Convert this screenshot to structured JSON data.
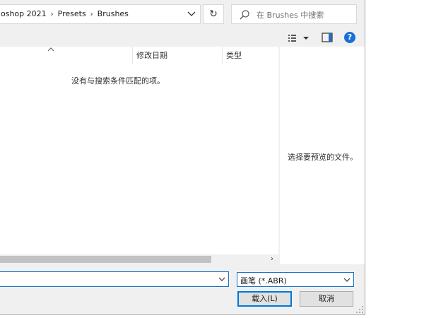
{
  "address": {
    "crumbs": [
      "oshop 2021",
      "Presets",
      "Brushes"
    ],
    "separator": "›",
    "refresh_glyph": "↻"
  },
  "search": {
    "placeholder": "在 Brushes 中搜索"
  },
  "toolbar": {
    "view_icon": "view-options-icon",
    "pane_icon": "preview-pane-icon",
    "help_label": "?"
  },
  "list": {
    "columns": {
      "date": "修改日期",
      "type": "类型"
    },
    "empty_message": "没有与搜索条件匹配的项。",
    "scroll_right_glyph": "›"
  },
  "preview": {
    "message": "选择要预览的文件。"
  },
  "filename": {
    "value": ""
  },
  "filetype": {
    "selected": "画笔 (*.ABR)"
  },
  "buttons": {
    "load": "载入(L)",
    "cancel": "取消"
  },
  "colors": {
    "accent": "#0078d7",
    "help": "#1a6fd6"
  }
}
